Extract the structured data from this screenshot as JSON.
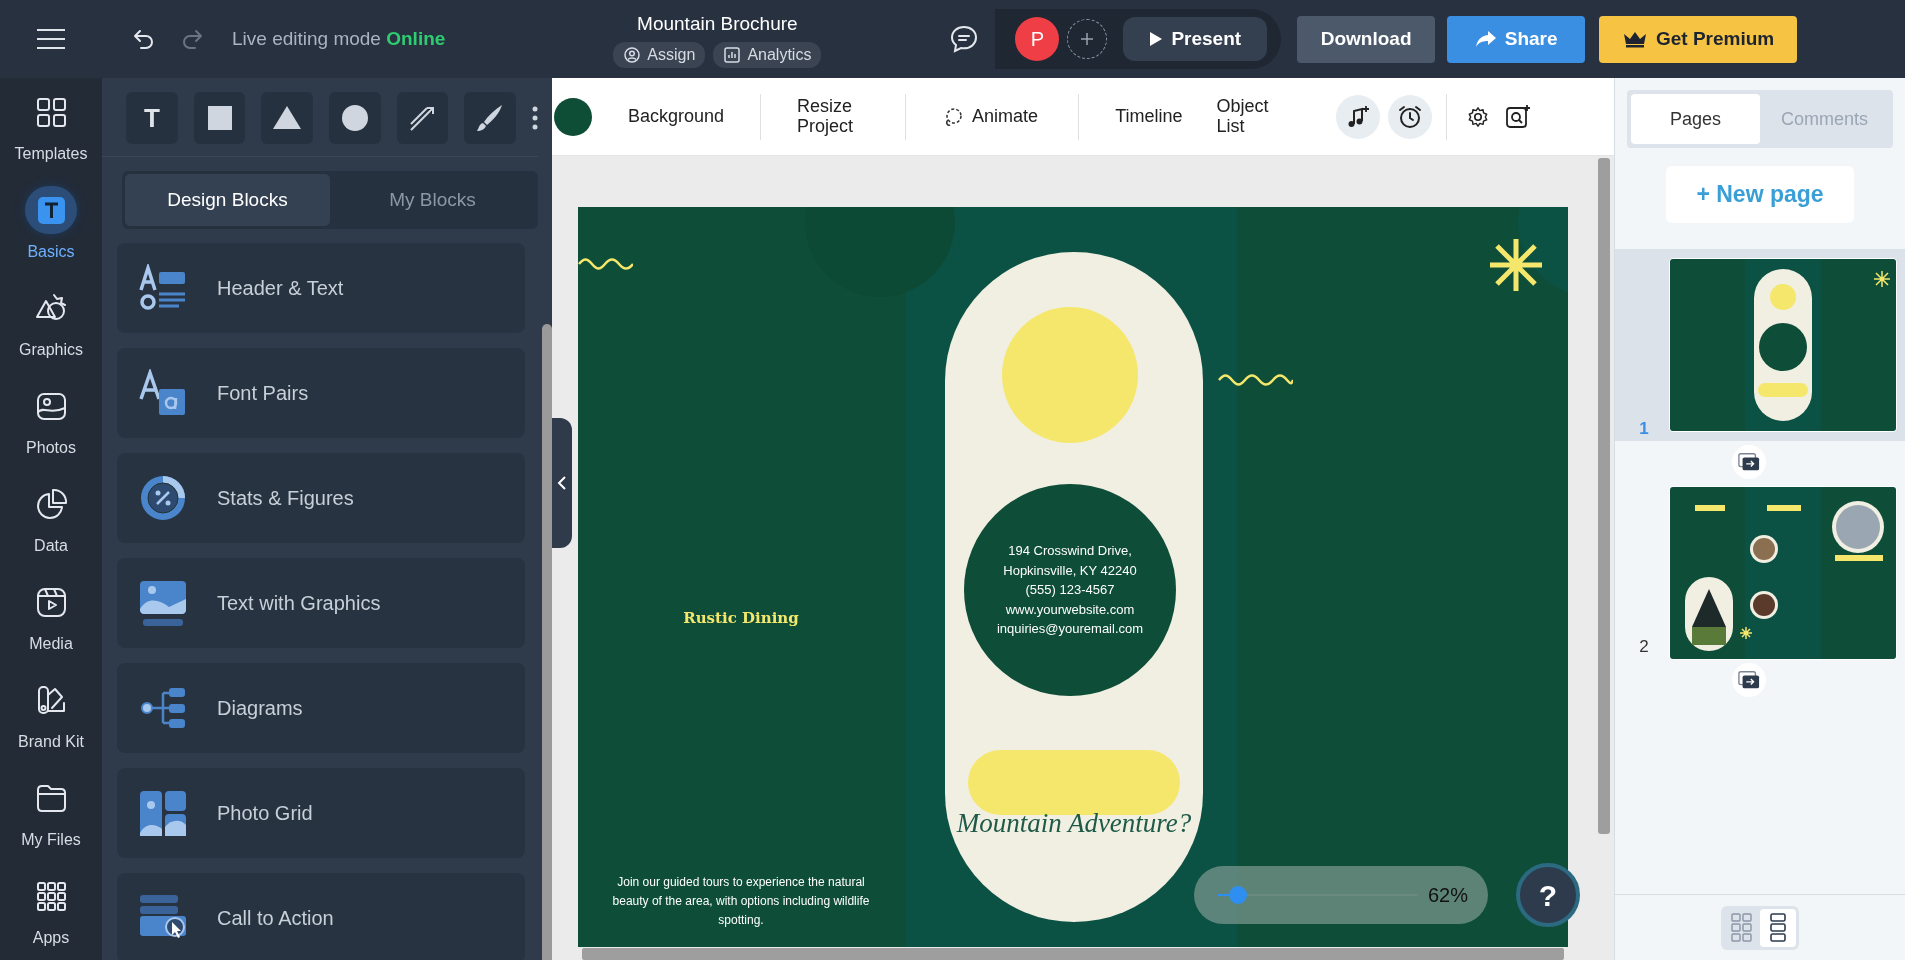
{
  "top_bar": {
    "history": [
      {
        "kind": "undo",
        "disabled": false
      },
      {
        "kind": "redo",
        "disabled": true
      }
    ],
    "mode_label": "Live editing mode",
    "mode_status": "Online",
    "title": "Mountain Brochure",
    "title_links": [
      "Assign",
      "Analytics"
    ],
    "avatar_initial": "P",
    "present": "Present",
    "download": "Download",
    "share": "Share",
    "premium": "Get Premium"
  },
  "rail": [
    {
      "label": "Templates",
      "selected": false
    },
    {
      "label": "Basics",
      "selected": true
    },
    {
      "label": "Graphics",
      "selected": false
    },
    {
      "label": "Photos",
      "selected": false
    },
    {
      "label": "Data",
      "selected": false
    },
    {
      "label": "Media",
      "selected": false
    },
    {
      "label": "Brand Kit",
      "selected": false
    },
    {
      "label": "My Files",
      "selected": false
    },
    {
      "label": "Apps",
      "selected": false
    }
  ],
  "panel": {
    "tools": [
      "T"
    ],
    "tabs": [
      {
        "label": "Design Blocks",
        "selected": true
      },
      {
        "label": "My Blocks",
        "selected": false
      }
    ],
    "blocks": [
      "Header & Text",
      "Font Pairs",
      "Stats & Figures",
      "Text with Graphics",
      "Diagrams",
      "Photo Grid",
      "Call to Action"
    ]
  },
  "toolbar": {
    "color": "#0e4d36",
    "items": [
      "Background",
      "Resize Project",
      "Animate",
      "Timeline",
      "Object List"
    ]
  },
  "canvas": {
    "heading": "Rustic Dining",
    "intro": "Join our guided tours to experience the natural beauty of the area, with options including wildlife spotting.",
    "address_lines": [
      "194 Crosswind Drive,",
      "Hopkinsville, KY 42240",
      "(555) 123-4567",
      "www.yourwebsite.com",
      "inquiries@youremail.com"
    ],
    "tagline": "Mountain Adventure?"
  },
  "zoom": {
    "level": 0.1,
    "reading": "62%"
  },
  "help": "?",
  "pages_panel": {
    "tabs": [
      {
        "label": "Pages",
        "selected": true
      },
      {
        "label": "Comments",
        "selected": false
      }
    ],
    "new_page": "+ New page",
    "pages": [
      {
        "number": "1",
        "selected": true
      },
      {
        "number": "2",
        "selected": false
      }
    ],
    "view_modes": [
      {
        "kind": "grid",
        "selected": false
      },
      {
        "kind": "list",
        "selected": true
      }
    ]
  }
}
